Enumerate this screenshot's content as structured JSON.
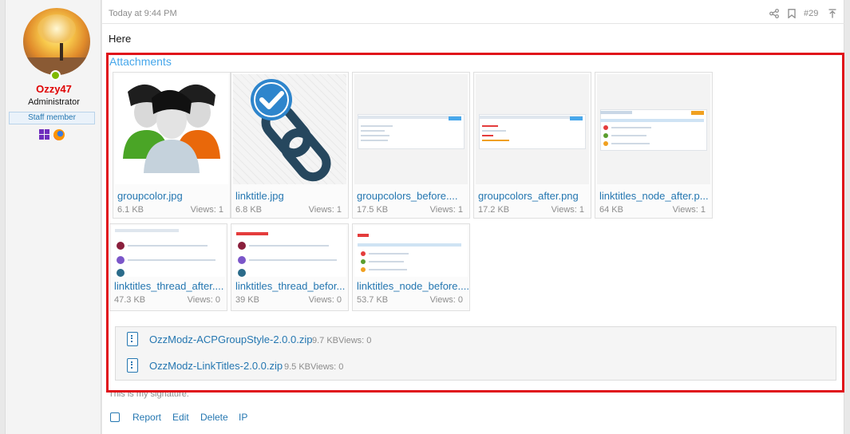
{
  "user": {
    "name": "Ozzy47",
    "title": "Administrator",
    "badge": "Staff member"
  },
  "post": {
    "timestamp": "Today at 9:44 PM",
    "number": "#29",
    "message": "Here",
    "signature": "This is my signature."
  },
  "attachments": {
    "title": "Attachments",
    "thumbnails": [
      {
        "name": "groupcolor.jpg",
        "size": "6.1 KB",
        "views": "Views: 1"
      },
      {
        "name": "linktitle.jpg",
        "size": "6.8 KB",
        "views": "Views: 1"
      },
      {
        "name": "groupcolors_before....",
        "size": "17.5 KB",
        "views": "Views: 1"
      },
      {
        "name": "groupcolors_after.png",
        "size": "17.2 KB",
        "views": "Views: 1"
      },
      {
        "name": "linktitles_node_after.p...",
        "size": "64 KB",
        "views": "Views: 1"
      },
      {
        "name": "linktitles_thread_after....",
        "size": "47.3 KB",
        "views": "Views: 0"
      },
      {
        "name": "linktitles_thread_befor...",
        "size": "39 KB",
        "views": "Views: 0"
      },
      {
        "name": "linktitles_node_before....",
        "size": "53.7 KB",
        "views": "Views: 0"
      }
    ],
    "files": [
      {
        "name": "OzzModz-ACPGroupStyle-2.0.0.zip",
        "meta": "9.7 KBViews: 0"
      },
      {
        "name": "OzzModz-LinkTitles-2.0.0.zip",
        "meta": "9.5 KBViews: 0"
      }
    ]
  },
  "actions": {
    "report": "Report",
    "edit": "Edit",
    "delete": "Delete",
    "ip": "IP"
  },
  "colors": {
    "username": "#e00000",
    "link": "#2577b1",
    "accent": "#47a7eb",
    "highlight_outline": "#e0101a"
  },
  "icons": [
    "share-icon",
    "bookmark-icon",
    "scroll-top-icon",
    "windows-icon",
    "firefox-icon",
    "zip-file-icon"
  ]
}
